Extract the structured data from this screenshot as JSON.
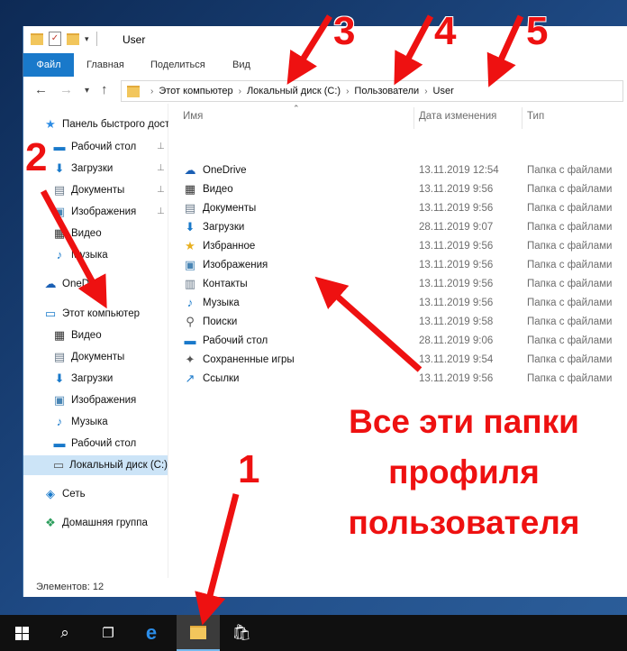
{
  "window": {
    "title": "User",
    "ribbon_tabs": [
      "Файл",
      "Главная",
      "Поделиться",
      "Вид"
    ],
    "address": [
      "Этот компьютер",
      "Локальный диск (C:)",
      "Пользователи",
      "User"
    ]
  },
  "sidebar": {
    "items": [
      {
        "label": "Панель быстрого доступа",
        "icon": "star-icon",
        "indent": 0,
        "pinned": false
      },
      {
        "label": "Рабочий стол",
        "icon": "desktop-icon",
        "indent": 1,
        "pinned": true
      },
      {
        "label": "Загрузки",
        "icon": "download-icon",
        "indent": 1,
        "pinned": true
      },
      {
        "label": "Документы",
        "icon": "document-icon",
        "indent": 1,
        "pinned": true
      },
      {
        "label": "Изображения",
        "icon": "pictures-icon",
        "indent": 1,
        "pinned": true
      },
      {
        "label": "Видео",
        "icon": "video-icon",
        "indent": 1,
        "pinned": false
      },
      {
        "label": "Музыка",
        "icon": "music-icon",
        "indent": 1,
        "pinned": false
      },
      {
        "label": "OneDrive",
        "icon": "onedrive-icon",
        "indent": 0,
        "pinned": false
      },
      {
        "label": "Этот компьютер",
        "icon": "computer-icon",
        "indent": 0,
        "pinned": false
      },
      {
        "label": "Видео",
        "icon": "video-icon",
        "indent": 1,
        "pinned": false
      },
      {
        "label": "Документы",
        "icon": "document-icon",
        "indent": 1,
        "pinned": false
      },
      {
        "label": "Загрузки",
        "icon": "download-icon",
        "indent": 1,
        "pinned": false
      },
      {
        "label": "Изображения",
        "icon": "pictures-icon",
        "indent": 1,
        "pinned": false
      },
      {
        "label": "Музыка",
        "icon": "music-icon",
        "indent": 1,
        "pinned": false
      },
      {
        "label": "Рабочий стол",
        "icon": "desktop-icon",
        "indent": 1,
        "pinned": false
      },
      {
        "label": "Локальный диск (C:)",
        "icon": "drive-icon",
        "indent": 1,
        "pinned": false,
        "selected": true
      },
      {
        "label": "Сеть",
        "icon": "network-icon",
        "indent": 0,
        "pinned": false
      },
      {
        "label": "Домашняя группа",
        "icon": "homegroup-icon",
        "indent": 0,
        "pinned": false
      }
    ]
  },
  "columns": [
    "Имя",
    "Дата изменения",
    "Тип"
  ],
  "files": [
    {
      "name": "OneDrive",
      "date": "13.11.2019 12:54",
      "type": "Папка с файлами",
      "icon": "onedrive-icon"
    },
    {
      "name": "Видео",
      "date": "13.11.2019 9:56",
      "type": "Папка с файлами",
      "icon": "video-icon"
    },
    {
      "name": "Документы",
      "date": "13.11.2019 9:56",
      "type": "Папка с файлами",
      "icon": "document-icon"
    },
    {
      "name": "Загрузки",
      "date": "28.11.2019 9:07",
      "type": "Папка с файлами",
      "icon": "download-icon"
    },
    {
      "name": "Избранное",
      "date": "13.11.2019 9:56",
      "type": "Папка с файлами",
      "icon": "favorites-icon"
    },
    {
      "name": "Изображения",
      "date": "13.11.2019 9:56",
      "type": "Папка с файлами",
      "icon": "pictures-icon"
    },
    {
      "name": "Контакты",
      "date": "13.11.2019 9:56",
      "type": "Папка с файлами",
      "icon": "contacts-icon"
    },
    {
      "name": "Музыка",
      "date": "13.11.2019 9:56",
      "type": "Папка с файлами",
      "icon": "music-icon"
    },
    {
      "name": "Поиски",
      "date": "13.11.2019 9:58",
      "type": "Папка с файлами",
      "icon": "search-icon"
    },
    {
      "name": "Рабочий стол",
      "date": "28.11.2019 9:06",
      "type": "Папка с файлами",
      "icon": "desktop-icon"
    },
    {
      "name": "Сохраненные игры",
      "date": "13.11.2019 9:54",
      "type": "Папка с файлами",
      "icon": "games-icon"
    },
    {
      "name": "Ссылки",
      "date": "13.11.2019 9:56",
      "type": "Папка с файлами",
      "icon": "links-icon"
    }
  ],
  "status": {
    "items_count": "Элементов: 12"
  },
  "annotations": {
    "numbers": [
      "1",
      "2",
      "3",
      "4",
      "5"
    ],
    "caption": [
      "Все эти папки",
      "профиля",
      "пользователя"
    ],
    "color": "#ee1111"
  },
  "colors": {
    "accent": "#1979ca",
    "selection": "#cce4f7"
  }
}
